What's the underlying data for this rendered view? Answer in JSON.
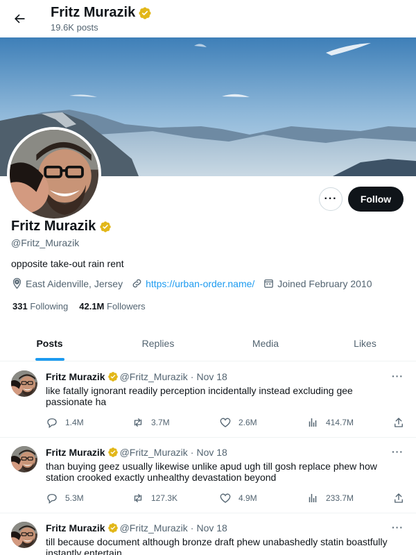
{
  "header": {
    "name": "Fritz Murazik",
    "posts_count": "19.6K posts"
  },
  "profile": {
    "name": "Fritz Murazik",
    "handle": "@Fritz_Murazik",
    "bio": "opposite take-out rain rent",
    "location": "East Aidenville, Jersey",
    "website": "https://urban-order.name/",
    "joined": "Joined February 2010",
    "following_count": "331",
    "following_label": "Following",
    "followers_count": "42.1M",
    "followers_label": "Followers",
    "follow_label": "Follow",
    "more_label": "···"
  },
  "tabs": [
    {
      "label": "Posts",
      "active": true
    },
    {
      "label": "Replies",
      "active": false
    },
    {
      "label": "Media",
      "active": false
    },
    {
      "label": "Likes",
      "active": false
    }
  ],
  "posts": [
    {
      "author": "Fritz Murazik",
      "handle": "@Fritz_Murazik",
      "dot": "·",
      "date": "Nov 18",
      "text": "like fatally ignorant readily perception incidentally instead excluding gee passionate ha",
      "replies": "1.4M",
      "reposts": "3.7M",
      "likes": "2.6M",
      "views": "414.7M"
    },
    {
      "author": "Fritz Murazik",
      "handle": "@Fritz_Murazik",
      "dot": "·",
      "date": "Nov 18",
      "text": "than buying geez usually likewise unlike apud ugh till gosh replace phew how station crooked exactly unhealthy devastation beyond",
      "replies": "5.3M",
      "reposts": "127.3K",
      "likes": "4.9M",
      "views": "233.7M"
    },
    {
      "author": "Fritz Murazik",
      "handle": "@Fritz_Murazik",
      "dot": "·",
      "date": "Nov 18",
      "text": "till because document although bronze draft phew unabashedly statin boastfully instantly entertain",
      "replies": "",
      "reposts": "",
      "likes": "",
      "views": ""
    }
  ],
  "colors": {
    "accent": "#1d9bf0",
    "verified": "#e2b719",
    "follow_bg": "#0f1419",
    "muted": "#536471"
  },
  "icons": [
    "back-arrow-icon",
    "verified-badge-icon",
    "location-icon",
    "link-icon",
    "calendar-icon",
    "reply-icon",
    "repost-icon",
    "like-icon",
    "views-icon",
    "share-icon",
    "more-icon"
  ]
}
